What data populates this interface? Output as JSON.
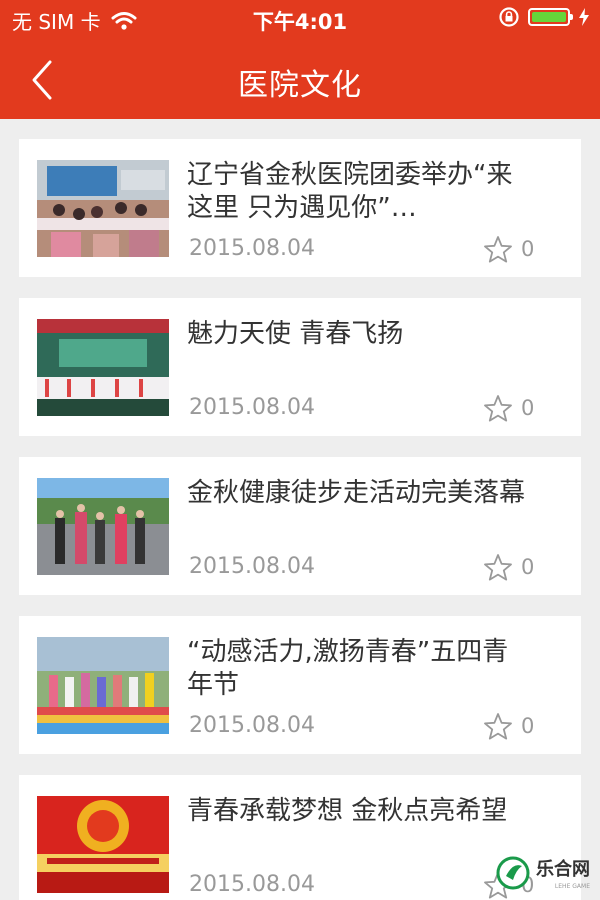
{
  "status_bar": {
    "carrier": "无 SIM 卡",
    "time": "下午4:01",
    "wifi_icon": "wifi-icon",
    "lock_icon": "rotation-lock-icon",
    "battery_icon": "battery-icon",
    "charging_icon": "charging-icon",
    "battery_level": 1.0
  },
  "nav": {
    "title": "医院文化",
    "back_icon": "back-chevron-icon",
    "accent_color": "#e23a1e"
  },
  "articles": [
    {
      "title": "辽宁省金秋医院团委举办“来这里 只为遇见你”…",
      "date": "2015.08.04",
      "likes": "0",
      "star_icon": "star-outline-icon"
    },
    {
      "title": "魅力天使 青春飞扬",
      "date": "2015.08.04",
      "likes": "0",
      "star_icon": "star-outline-icon"
    },
    {
      "title": "金秋健康徒步走活动完美落幕",
      "date": "2015.08.04",
      "likes": "0",
      "star_icon": "star-outline-icon"
    },
    {
      "title": "“动感活力,激扬青春”五四青年节",
      "date": "2015.08.04",
      "likes": "0",
      "star_icon": "star-outline-icon"
    },
    {
      "title": "青春承载梦想 金秋点亮希望",
      "date": "2015.08.04",
      "likes": "0",
      "star_icon": "star-outline-icon"
    }
  ],
  "watermark": {
    "text": "乐合网",
    "subtext": "LEHE GAME"
  }
}
